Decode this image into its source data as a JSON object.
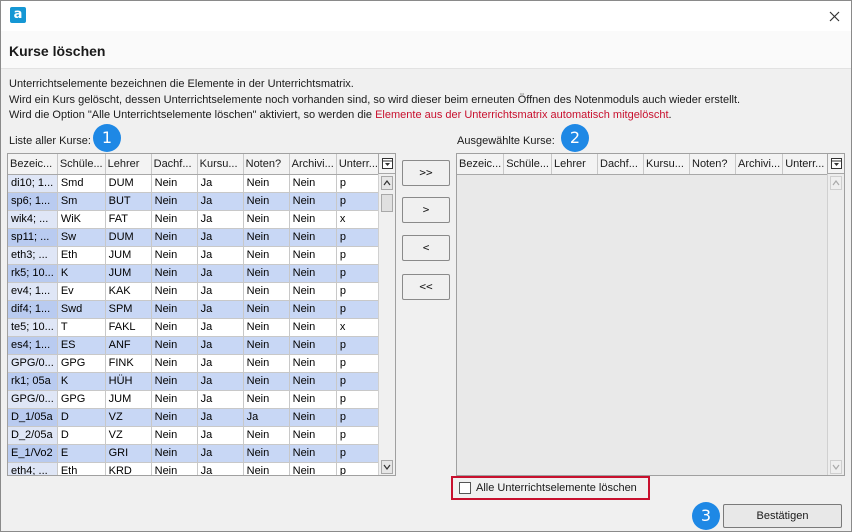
{
  "window": {
    "logo_letter": "a"
  },
  "header": {
    "title": "Kurse löschen"
  },
  "description": {
    "line1": "Unterrichtselemente bezeichnen die Elemente in der Unterrichtsmatrix.",
    "line2": "Wird ein Kurs gelöscht, dessen Unterrichtselemente noch vorhanden sind, so wird dieser beim erneuten Öffnen des Notenmoduls auch wieder erstellt.",
    "line3_prefix": "Wird die Option \"Alle Unterrichtselemente löschen\" aktiviert, so werden die ",
    "line3_highlight": "Elemente aus der Unterrichtsmatrix automatisch mitgelöscht",
    "line3_suffix": "."
  },
  "left_list": {
    "label": "Liste aller Kurse:",
    "badge": "1",
    "columns": [
      "Bezeic...",
      "Schüle...",
      "Lehrer",
      "Dachf...",
      "Kursu...",
      "Noten?",
      "Archivi...",
      "Unterr..."
    ],
    "rows": [
      [
        "di10; 1...",
        "Smd",
        "DUM",
        "Nein",
        "Ja",
        "Nein",
        "Nein",
        "p"
      ],
      [
        "sp6; 1...",
        "Sm",
        "BUT",
        "Nein",
        "Ja",
        "Nein",
        "Nein",
        "p"
      ],
      [
        "wik4; ...",
        "WiK",
        "FAT",
        "Nein",
        "Ja",
        "Nein",
        "Nein",
        "x"
      ],
      [
        "sp11; ...",
        "Sw",
        "DUM",
        "Nein",
        "Ja",
        "Nein",
        "Nein",
        "p"
      ],
      [
        "eth3; ...",
        "Eth",
        "JUM",
        "Nein",
        "Ja",
        "Nein",
        "Nein",
        "p"
      ],
      [
        "rk5; 10...",
        "K",
        "JUM",
        "Nein",
        "Ja",
        "Nein",
        "Nein",
        "p"
      ],
      [
        "ev4; 1...",
        "Ev",
        "KAK",
        "Nein",
        "Ja",
        "Nein",
        "Nein",
        "p"
      ],
      [
        "dif4; 1...",
        "Swd",
        "SPM",
        "Nein",
        "Ja",
        "Nein",
        "Nein",
        "p"
      ],
      [
        "te5; 10...",
        "T",
        "FAKL",
        "Nein",
        "Ja",
        "Nein",
        "Nein",
        "x"
      ],
      [
        "es4; 1...",
        "ES",
        "ANF",
        "Nein",
        "Ja",
        "Nein",
        "Nein",
        "p"
      ],
      [
        "GPG/0...",
        "GPG",
        "FINK",
        "Nein",
        "Ja",
        "Nein",
        "Nein",
        "p"
      ],
      [
        "rk1; 05a",
        "K",
        "HÜH",
        "Nein",
        "Ja",
        "Nein",
        "Nein",
        "p"
      ],
      [
        "GPG/0...",
        "GPG",
        "JUM",
        "Nein",
        "Ja",
        "Nein",
        "Nein",
        "p"
      ],
      [
        "D_1/05a",
        "D",
        "VZ",
        "Nein",
        "Ja",
        "Ja",
        "Nein",
        "p"
      ],
      [
        "D_2/05a",
        "D",
        "VZ",
        "Nein",
        "Ja",
        "Nein",
        "Nein",
        "p"
      ],
      [
        "E_1/Vo2",
        "E",
        "GRI",
        "Nein",
        "Ja",
        "Nein",
        "Nein",
        "p"
      ],
      [
        "eth4; ...",
        "Eth",
        "KRD",
        "Nein",
        "Ja",
        "Nein",
        "Nein",
        "p"
      ]
    ]
  },
  "transfer_buttons": {
    "add_all": ">>",
    "add_one": ">",
    "remove_one": "<",
    "remove_all": "<<"
  },
  "right_list": {
    "label": "Ausgewählte Kurse:",
    "badge": "2",
    "columns": [
      "Bezeic...",
      "Schüle...",
      "Lehrer",
      "Dachf...",
      "Kursu...",
      "Noten?",
      "Archivi...",
      "Unterr..."
    ]
  },
  "option": {
    "delete_all_label": "Alle Unterrichtselemente löschen",
    "checked": false
  },
  "footer": {
    "badge": "3",
    "confirm_label": "Bestätigen"
  },
  "colors": {
    "accent": "#1e88e5",
    "highlight_red": "#c8102e",
    "row_alt": "#c8d7f5"
  }
}
